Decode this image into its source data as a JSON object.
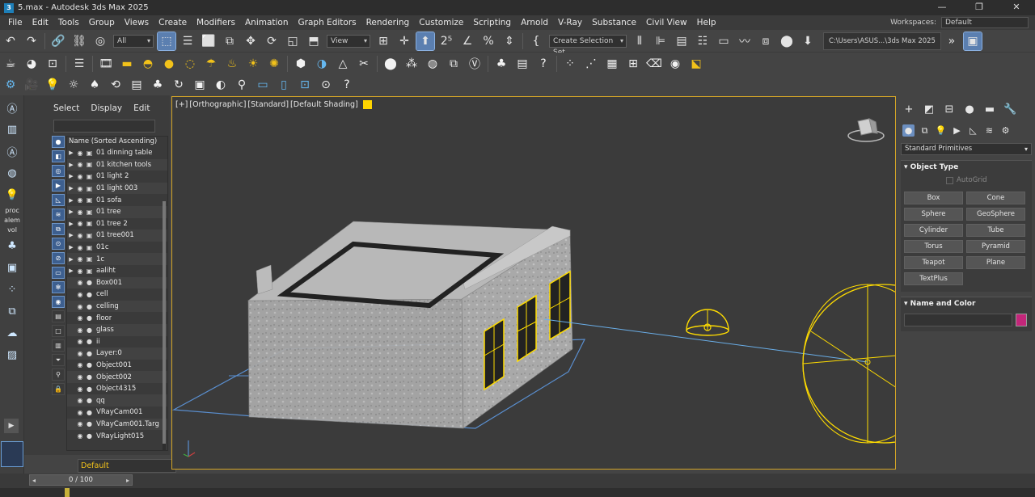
{
  "window": {
    "title": "5.max - Autodesk 3ds Max 2025",
    "app_icon_label": "3",
    "controls": [
      "—",
      "❐",
      "✕"
    ]
  },
  "menu": {
    "items": [
      "File",
      "Edit",
      "Tools",
      "Group",
      "Views",
      "Create",
      "Modifiers",
      "Animation",
      "Graph Editors",
      "Rendering",
      "Customize",
      "Scripting",
      "Arnold",
      "V-Ray",
      "Substance",
      "Civil View",
      "Help"
    ],
    "workspace_label": "Workspaces:",
    "workspace_value": "Default"
  },
  "toolbar": {
    "selection_filter": "All",
    "reference_coord": "View",
    "named_selection_set": "Create Selection Set",
    "project_path": "C:\\Users\\ASUS...\\3ds Max 2025"
  },
  "left_strip": {
    "labels": [
      "proc",
      "alem",
      "vol"
    ]
  },
  "scene_explorer": {
    "tabs": [
      "Select",
      "Display",
      "Edit"
    ],
    "column_header": "Name (Sorted Ascending)",
    "items": [
      {
        "name": "01 dinning table",
        "group": true
      },
      {
        "name": "01 kitchen tools",
        "group": true
      },
      {
        "name": "01 light 2",
        "group": true
      },
      {
        "name": "01 light 003",
        "group": true
      },
      {
        "name": "01 sofa",
        "group": true
      },
      {
        "name": "01 tree",
        "group": true
      },
      {
        "name": "01 tree 2",
        "group": true
      },
      {
        "name": "01 tree001",
        "group": true
      },
      {
        "name": "01c",
        "group": true
      },
      {
        "name": "1c",
        "group": true
      },
      {
        "name": "aaliht",
        "group": true
      },
      {
        "name": "Box001",
        "group": false
      },
      {
        "name": "cell",
        "group": false
      },
      {
        "name": "celling",
        "group": false
      },
      {
        "name": "floor",
        "group": false
      },
      {
        "name": "glass",
        "group": false
      },
      {
        "name": "ii",
        "group": false
      },
      {
        "name": "Layer:0",
        "group": false
      },
      {
        "name": "Object001",
        "group": false
      },
      {
        "name": "Object002",
        "group": false
      },
      {
        "name": "Object4315",
        "group": false
      },
      {
        "name": "qq",
        "group": false
      },
      {
        "name": "VRayCam001",
        "group": false
      },
      {
        "name": "VRayCam001.Targ",
        "group": false
      },
      {
        "name": "VRayLight015",
        "group": false
      }
    ],
    "layer_field": "Default"
  },
  "viewport": {
    "labels": [
      "[+]",
      "[Orthographic]",
      "[Standard]",
      "[Default Shading]"
    ],
    "accent_color": "#ffd500",
    "border_color": "#d4a527"
  },
  "command_panel": {
    "category": "Standard Primitives",
    "object_type_title": "Object Type",
    "autogrid_label": "AutoGrid",
    "buttons": [
      "Box",
      "Cone",
      "Sphere",
      "GeoSphere",
      "Cylinder",
      "Tube",
      "Torus",
      "Pyramid",
      "Teapot",
      "Plane",
      "TextPlus"
    ],
    "name_color_title": "Name and Color",
    "object_color": "#c3267a"
  },
  "timeline": {
    "frame_counter": "0 / 100"
  }
}
